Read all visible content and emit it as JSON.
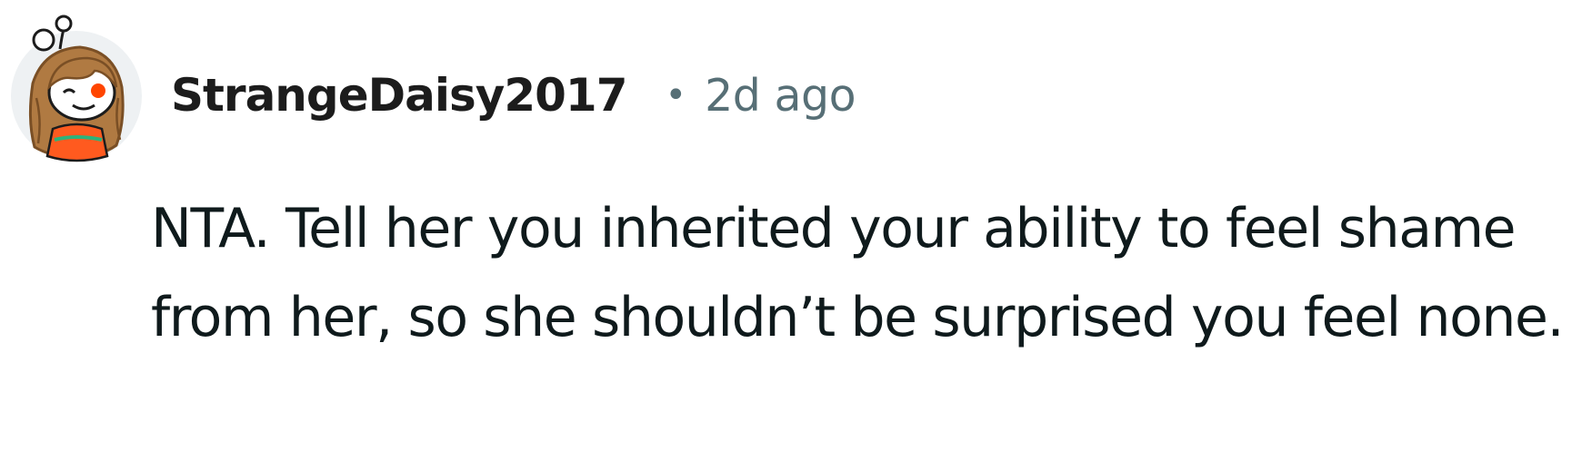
{
  "comment": {
    "author": "StrangeDaisy2017",
    "separator": "•",
    "timestamp": "2d ago",
    "body": "NTA. Tell her you inherited your ability to feel shame from her, so she shouldn’t be surprised you feel none."
  },
  "avatar": {
    "icon": "snoo-avatar-icon",
    "colors": {
      "background": "#eef1f3",
      "hair": "#b07a42",
      "skin": "#ffffff",
      "eye": "#ff4500",
      "shirt": "#ff5a1f"
    }
  },
  "colors": {
    "username": "#1c1c1c",
    "meta": "#576f76",
    "body_text": "#0f1a1c"
  }
}
